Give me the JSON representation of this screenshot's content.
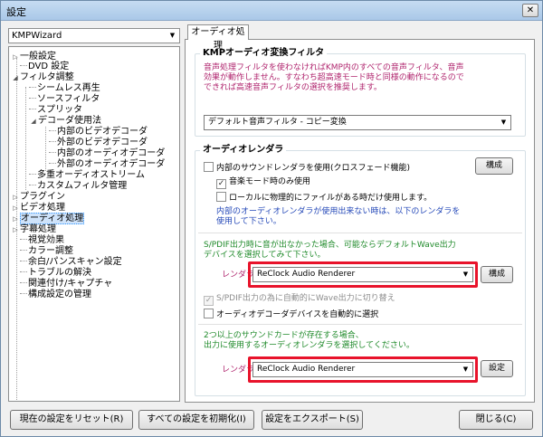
{
  "window": {
    "title": "設定",
    "close_label": "✕"
  },
  "left": {
    "preset": "KMPWizard",
    "tree": [
      {
        "label": "一般設定"
      },
      {
        "label": "DVD 設定"
      },
      {
        "label": "フィルタ調整"
      },
      {
        "label": "シームレス再生"
      },
      {
        "label": "ソースフィルタ"
      },
      {
        "label": "スプリッタ"
      },
      {
        "label": "デコーダ使用法"
      },
      {
        "label": "内部のビデオデコーダ"
      },
      {
        "label": "外部のビデオデコーダ"
      },
      {
        "label": "内部のオーディオデコーダ"
      },
      {
        "label": "外部のオーディオデコーダ"
      },
      {
        "label": "多重オーディオストリーム"
      },
      {
        "label": "カスタムフィルタ管理"
      },
      {
        "label": "プラグイン"
      },
      {
        "label": "ビデオ処理"
      },
      {
        "label": "オーディオ処理"
      },
      {
        "label": "字幕処理"
      },
      {
        "label": "視覚効果"
      },
      {
        "label": "カラー調整"
      },
      {
        "label": "余白/パンスキャン設定"
      },
      {
        "label": "トラブルの解決"
      },
      {
        "label": "関連付け/キャプチャ"
      },
      {
        "label": "構成設定の管理"
      }
    ]
  },
  "tab_label": "オーディオ処理",
  "kmp_filter": {
    "title": "KMPオーディオ変換フィルタ",
    "desc_line1": "音声処理フィルタを使わなければKMP内のすべての音声フィルタ、音声",
    "desc_line2": "効果が動作しません。すなわち超高速モード時と同様の動作になるので",
    "desc_line3": "できれば高速音声フィルタの選択を推奨します。",
    "combo_value": "デフォルト音声フィルタ - コピー変換"
  },
  "renderer": {
    "title": "オーディオレンダラ",
    "use_internal": "内部のサウンドレンダラを使用(クロスフェード機能)",
    "config_button": "構成",
    "music_mode": "音楽モード時のみ使用",
    "local_only": "ローカルに物理的にファイルがある時だけ使用します。",
    "note_line1": "内部のオーディオレンダラが使用出来ない時は、以下のレンダラを",
    "note_line2": "使用して下さい。",
    "spdif_line1": "S/PDIF出力時に音が出なかった場合、可能ならデフォルトWave出力",
    "spdif_line2": "デバイスを選択してみて下さい。",
    "renderer_label": "レンダラ",
    "renderer_value": "ReClock Audio Renderer",
    "renderer_config": "構成",
    "spdif_auto": "S/PDIF出力の為に自動的にWave出力に切り替え",
    "auto_decoder": "オーディオデコーダデバイスを自動的に選択",
    "multi_line1": "2つ以上のサウンドカードが存在する場合、",
    "multi_line2": "出力に使用するオーディオレンダラを選択してください。",
    "renderer2_label": "レンダラ",
    "renderer2_value": "ReClock Audio Renderer",
    "settings_button": "設定"
  },
  "buttons": {
    "reset": "現在の設定をリセット(R)",
    "init": "すべての設定を初期化(I)",
    "export": "設定をエクスポート(S)",
    "close": "閉じる(C)"
  }
}
